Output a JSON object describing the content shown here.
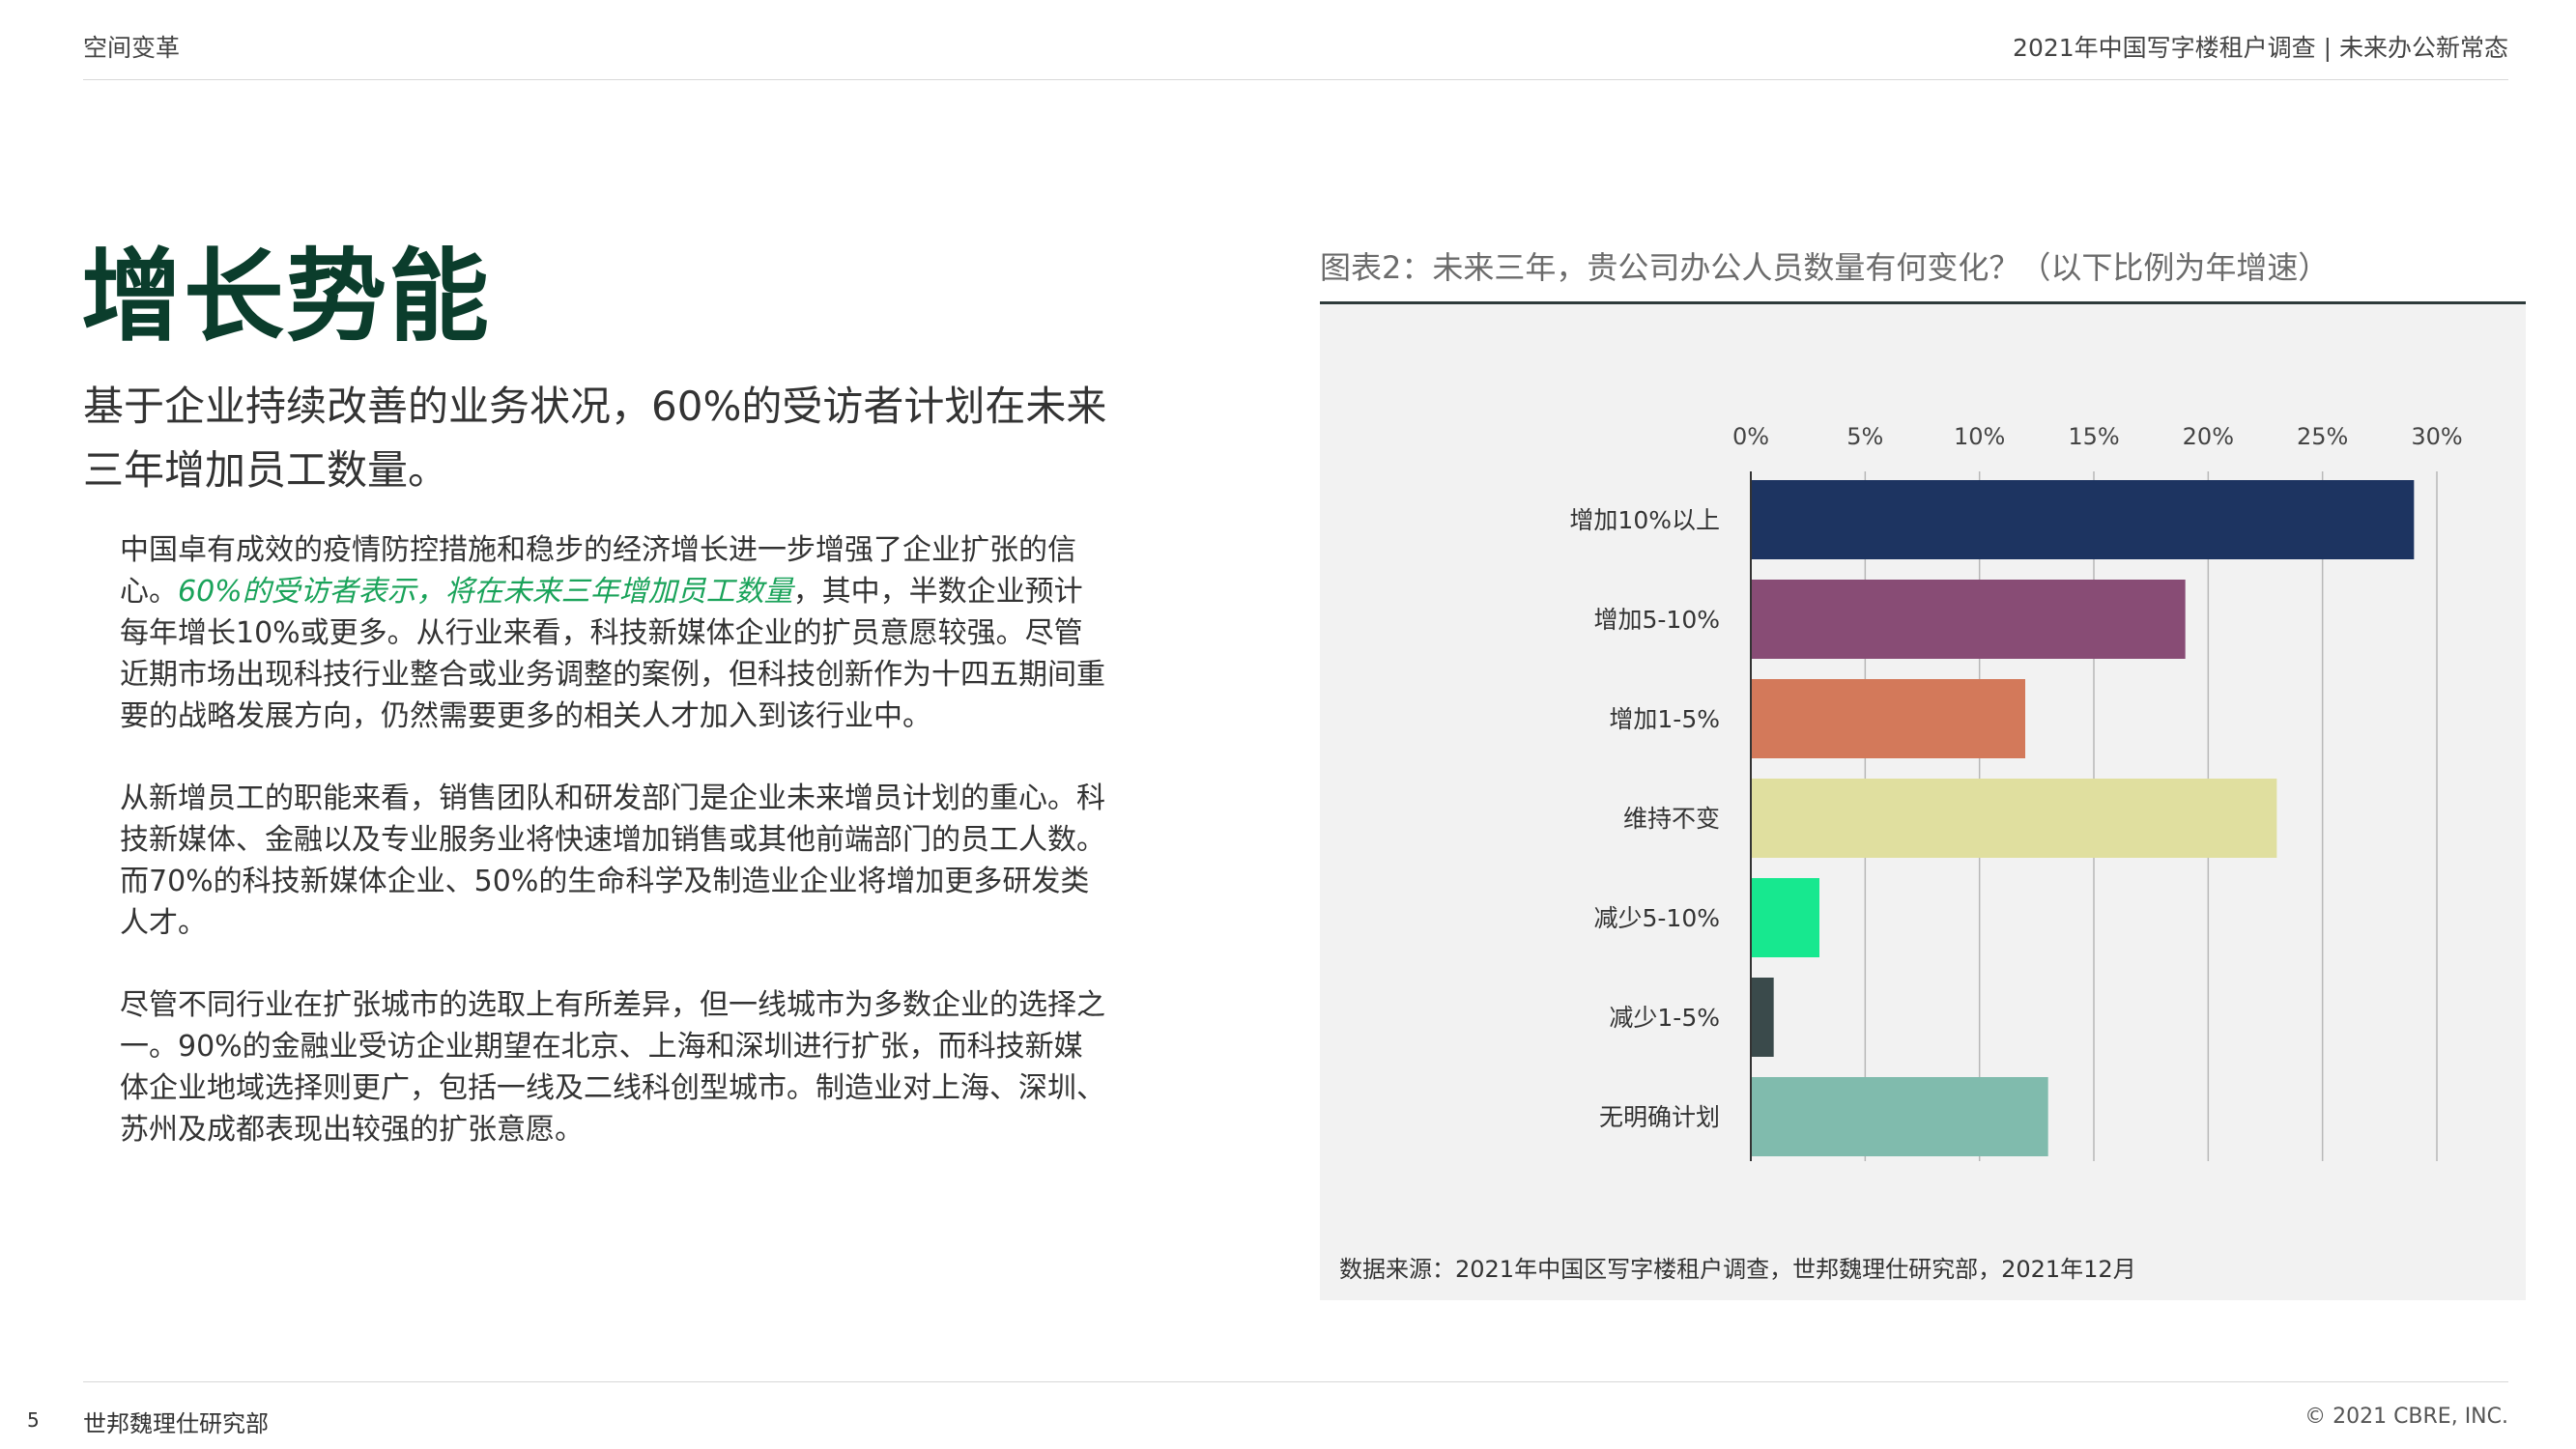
{
  "header": {
    "section": "空间变革",
    "report_title": "2021年中国写字楼租户调查 | 未来办公新常态"
  },
  "main": {
    "title": "增长势能",
    "subtitle": "基于企业持续改善的业务状况，60%的受访者计划在未来三年增加员工数量。",
    "paragraphs": [
      {
        "before": "中国卓有成效的疫情防控措施和稳步的经济增长进一步增强了企业扩张的信心。",
        "highlight": "60%的受访者表示，将在未来三年增加员工数量",
        "after": "，其中，半数企业预计每年增长10%或更多。从行业来看，科技新媒体企业的扩员意愿较强。尽管近期市场出现科技行业整合或业务调整的案例，但科技创新作为十四五期间重要的战略发展方向，仍然需要更多的相关人才加入到该行业中。"
      },
      {
        "text": "从新增员工的职能来看，销售团队和研发部门是企业未来增员计划的重心。科技新媒体、金融以及专业服务业将快速增加销售或其他前端部门的员工人数。而70%的科技新媒体企业、50%的生命科学及制造业企业将增加更多研发类人才。"
      },
      {
        "text": "尽管不同行业在扩张城市的选取上有所差异，但一线城市为多数企业的选择之一。90%的金融业受访企业期望在北京、上海和深圳进行扩张，而科技新媒体企业地域选择则更广，包括一线及二线科创型城市。制造业对上海、深圳、苏州及成都表现出较强的扩张意愿。"
      }
    ]
  },
  "chart_data": {
    "type": "bar",
    "orientation": "horizontal",
    "title": "图表2：未来三年，贵公司办公人员数量有何变化？（以下比例为年增速）",
    "categories": [
      "增加10%以上",
      "增加5-10%",
      "增加1-5%",
      "维持不变",
      "减少5-10%",
      "减少1-5%",
      "无明确计划"
    ],
    "values": [
      29,
      19,
      12,
      23,
      3,
      1,
      13
    ],
    "colors": [
      "#1d3461",
      "#884c75",
      "#d3795a",
      "#e0df9f",
      "#17e88f",
      "#3a4a4b",
      "#80bbad"
    ],
    "x_ticks": [
      "0%",
      "5%",
      "10%",
      "15%",
      "20%",
      "25%",
      "30%"
    ],
    "xlim": [
      0,
      30
    ],
    "axis_position": "top",
    "grid": true,
    "legend": "none",
    "source": "数据来源：2021年中国区写字楼租户调查，世邦魏理仕研究部，2021年12月"
  },
  "footer": {
    "page": "5",
    "org": "世邦魏理仕研究部",
    "copyright": "© 2021 CBRE, INC."
  }
}
